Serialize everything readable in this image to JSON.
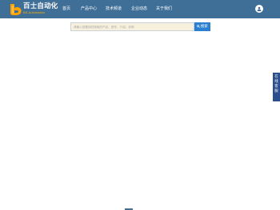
{
  "header": {
    "brand": {
      "name": "百士自动化",
      "subtitle": "BS-Automation"
    },
    "nav": [
      {
        "label": "首页"
      },
      {
        "label": "产品中心"
      },
      {
        "label": "技术频道"
      },
      {
        "label": "企业动态"
      },
      {
        "label": "关于我们"
      }
    ],
    "user_icon": "user-icon"
  },
  "search": {
    "placeholder": "请输入您要找的搜索的产品、型号、介绍、说明",
    "button_label": "搜索",
    "button_icon": "search-icon"
  },
  "side_tab": {
    "label_lines": [
      "在",
      "线",
      "客",
      "服"
    ]
  },
  "colors": {
    "header_bg": "#3f6e96",
    "accent": "#2a7fd0",
    "logo_orange": "#ffa200",
    "side_tab_bg": "#2a4f8c"
  }
}
